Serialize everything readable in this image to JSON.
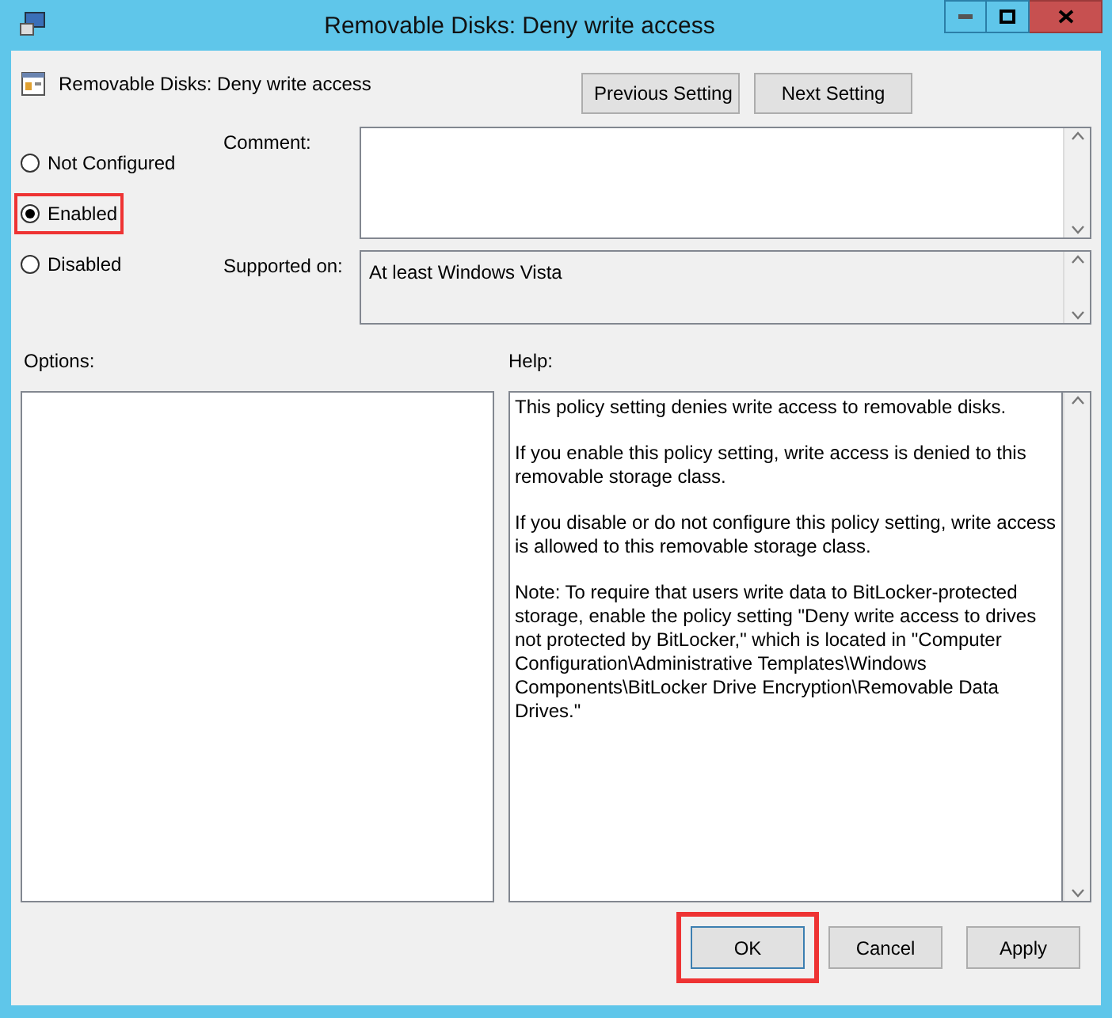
{
  "window": {
    "title": "Removable Disks: Deny write access"
  },
  "header": {
    "title": "Removable Disks: Deny write access",
    "buttons": [
      "Previous Setting",
      "Next Setting"
    ]
  },
  "options_state": [
    {
      "label": "Not Configured",
      "selected": false,
      "highlighted": false
    },
    {
      "label": "Enabled",
      "selected": true,
      "highlighted": true
    },
    {
      "label": "Disabled",
      "selected": false,
      "highlighted": false
    }
  ],
  "comment": {
    "label": "Comment:"
  },
  "supported_on": {
    "label": "Supported on:",
    "value": "At least Windows Vista"
  },
  "options": {
    "label": "Options:"
  },
  "help": {
    "label": "Help:",
    "paragraphs": [
      "This policy setting denies write access to removable disks.",
      "If you enable this policy setting, write access is denied to this removable storage class.",
      "If you disable or do not configure this policy setting, write access is allowed to this removable storage class.",
      "Note: To require that users write data to BitLocker-protected storage, enable the policy setting \"Deny write access to drives not protected by BitLocker,\" which is located in \"Computer Configuration\\Administrative Templates\\Windows Components\\BitLocker Drive Encryption\\Removable Data Drives.\""
    ]
  },
  "footer_buttons": [
    {
      "label": "OK",
      "highlighted": true
    },
    {
      "label": "Cancel",
      "highlighted": false
    },
    {
      "label": "Apply",
      "highlighted": false
    }
  ]
}
